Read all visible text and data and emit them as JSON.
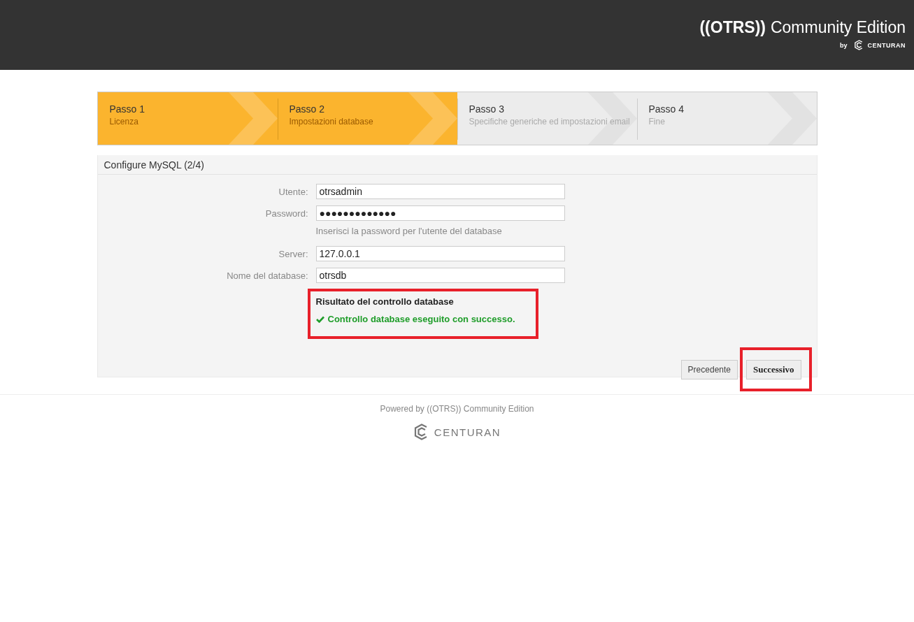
{
  "header": {
    "logo": "((OTRS))",
    "product": "Community Edition",
    "by": "by",
    "brand": "CENTURAN"
  },
  "steps": [
    {
      "title": "Passo 1",
      "subtitle": "Licenza",
      "done": true
    },
    {
      "title": "Passo 2",
      "subtitle": "Impostazioni database",
      "done": true
    },
    {
      "title": "Passo 3",
      "subtitle": "Specifiche generiche ed impostazioni email",
      "done": false
    },
    {
      "title": "Passo 4",
      "subtitle": "Fine",
      "done": false
    }
  ],
  "panel": {
    "title": "Configure MySQL (2/4)",
    "fields": [
      {
        "label": "Utente:",
        "value": "otrsadmin"
      },
      {
        "label": "Password:",
        "value": "●●●●●●●●●●●●●",
        "hint": "Inserisci la password per l'utente del database"
      },
      {
        "label": "Server:",
        "value": "127.0.0.1"
      },
      {
        "label": "Nome del database:",
        "value": "otrsdb"
      }
    ],
    "result": {
      "title": "Risultato del controllo database",
      "message": "Controllo database eseguito con successo.",
      "success": true
    },
    "buttons": [
      {
        "label": "Precedente",
        "primary": false
      },
      {
        "label": "Successivo",
        "primary": true
      }
    ]
  },
  "footer": {
    "powered": "Powered by ((OTRS)) Community Edition",
    "brand": "CENTURAN"
  }
}
